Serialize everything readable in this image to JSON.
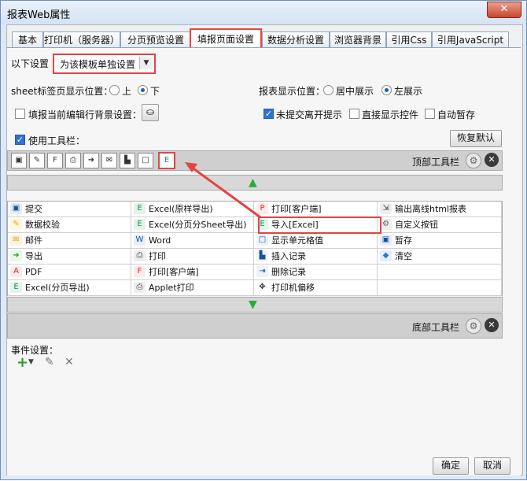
{
  "window": {
    "title": "报表Web属性",
    "close": "✕"
  },
  "tabs": [
    "基本",
    "打印机（服务器）",
    "分页预览设置",
    "填报页面设置",
    "数据分析设置",
    "浏览器背景",
    "引用Css",
    "引用JavaScript"
  ],
  "settings": {
    "label": "以下设置",
    "combo_value": "为该模板单独设置",
    "sheet_pos_label": "sheet标签页显示位置：",
    "opt_top": "上",
    "opt_bottom": "下",
    "report_pos_label": "报表显示位置：",
    "opt_center": "居中展示",
    "opt_left": "左展示",
    "bg_label": "填报当前编辑行背景设置：",
    "unsubmitted_label": "未提交离开提示",
    "direct_ctrl_label": "直接显示控件",
    "auto_save_label": "自动暂存",
    "use_toolbar_label": "使用工具栏：",
    "restore_default": "恢复默认",
    "top_toolbar": "顶部工具栏",
    "bottom_toolbar": "底部工具栏",
    "event_label": "事件设置："
  },
  "grid": [
    [
      "提交",
      "Excel(原样导出)",
      "打印[客户端]",
      "输出离线html报表"
    ],
    [
      "数据校验",
      "Excel(分页分Sheet导出)",
      "导入[Excel]",
      "自定义按钮"
    ],
    [
      "邮件",
      "Word",
      "显示单元格值",
      "暂存"
    ],
    [
      "导出",
      "打印",
      "插入记录",
      "清空"
    ],
    [
      "PDF",
      "打印[客户端]",
      "删除记录",
      ""
    ],
    [
      "Excel(分页导出)",
      "Applet打印",
      "打印机偏移",
      ""
    ]
  ],
  "grid_icons": [
    [
      "save-icon",
      "excel-icon",
      "pdf-print-icon",
      "offline-html-icon"
    ],
    [
      "pencil-icon",
      "excel-icon",
      "excel-import-icon",
      "gear-icon"
    ],
    [
      "mail-icon",
      "word-icon",
      "cell-value-icon",
      "temp-save-icon"
    ],
    [
      "export-icon",
      "print-icon",
      "insert-row-icon",
      "eraser-icon"
    ],
    [
      "pdf-icon",
      "flash-print-icon",
      "delete-row-icon",
      ""
    ],
    [
      "excel-icon",
      "applet-print-icon",
      "print-offset-icon",
      ""
    ]
  ],
  "footer": {
    "ok": "确定",
    "cancel": "取消"
  },
  "colors": {
    "accent_red": "#e34444",
    "excel_green": "#1f8a4c",
    "toolbar_gray": "#cfcfcf"
  }
}
